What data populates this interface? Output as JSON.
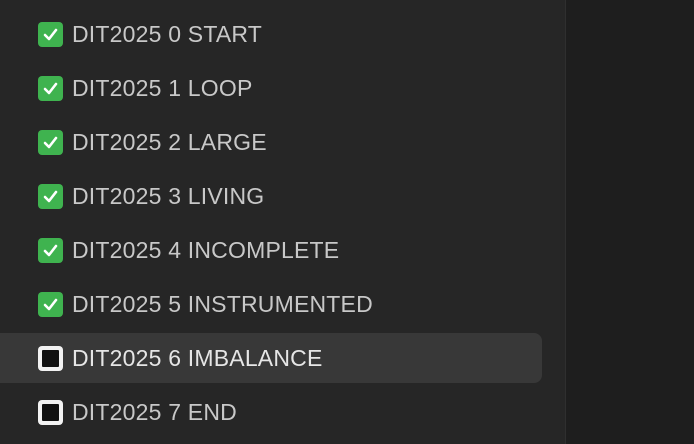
{
  "sidebar": {
    "items": [
      {
        "label": "DIT2025 0 START",
        "status": "done",
        "icon": "check-mark-button-icon"
      },
      {
        "label": "DIT2025 1 LOOP",
        "status": "done",
        "icon": "check-mark-button-icon"
      },
      {
        "label": "DIT2025 2 LARGE",
        "status": "done",
        "icon": "check-mark-button-icon"
      },
      {
        "label": "DIT2025 3 LIVING",
        "status": "done",
        "icon": "check-mark-button-icon"
      },
      {
        "label": "DIT2025 4 INCOMPLETE",
        "status": "done",
        "icon": "check-mark-button-icon"
      },
      {
        "label": "DIT2025 5 INSTRUMENTED",
        "status": "done",
        "icon": "check-mark-button-icon"
      },
      {
        "label": "DIT2025 6 IMBALANCE",
        "status": "todo",
        "icon": "black-square-button-icon",
        "selected": true
      },
      {
        "label": "DIT2025 7 END",
        "status": "todo",
        "icon": "black-square-button-icon"
      }
    ]
  },
  "colors": {
    "sidebar_bg": "#262626",
    "selected_bg": "#383838",
    "main_bg": "#1e1e1e",
    "done_green": "#3fb34f",
    "text": "#c8c8c8"
  }
}
